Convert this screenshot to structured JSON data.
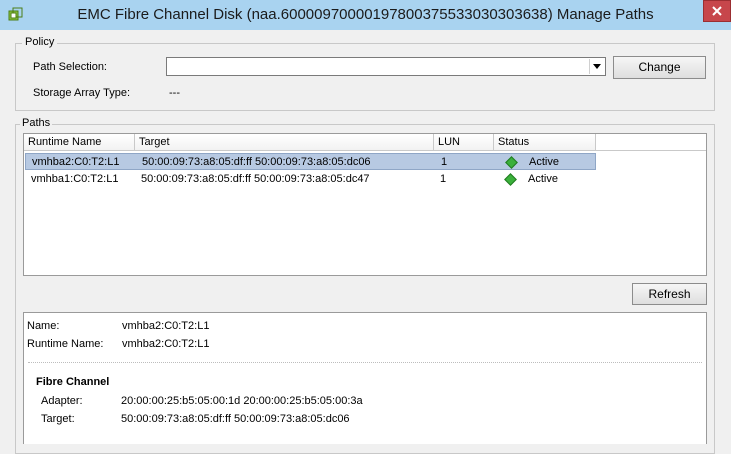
{
  "window": {
    "title": "EMC Fibre Channel Disk (naa.60000970000197800375533030303638) Manage Paths"
  },
  "policy": {
    "group_label": "Policy",
    "path_selection_label": "Path Selection:",
    "path_selection_value": "",
    "change_button": "Change",
    "storage_array_type_label": "Storage Array Type:",
    "storage_array_type_value": "---"
  },
  "paths": {
    "group_label": "Paths",
    "columns": [
      "Runtime Name",
      "Target",
      "LUN",
      "Status"
    ],
    "rows": [
      {
        "runtime_name": "vmhba2:C0:T2:L1",
        "target": "50:00:09:73:a8:05:df:ff 50:00:09:73:a8:05:dc06",
        "lun": "1",
        "status": "Active",
        "selected": true
      },
      {
        "runtime_name": "vmhba1:C0:T2:L1",
        "target": "50:00:09:73:a8:05:df:ff 50:00:09:73:a8:05:dc47",
        "lun": "1",
        "status": "Active",
        "selected": false
      }
    ],
    "refresh_button": "Refresh"
  },
  "details": {
    "name_label": "Name:",
    "name_value": "vmhba2:C0:T2:L1",
    "runtime_name_label": "Runtime Name:",
    "runtime_name_value": "vmhba2:C0:T2:L1",
    "section_title": "Fibre Channel",
    "adapter_label": "Adapter:",
    "adapter_value": "20:00:00:25:b5:05:00:1d 20:00:00:25:b5:05:00:3a",
    "target_label": "Target:",
    "target_value": "50:00:09:73:a8:05:df:ff 50:00:09:73:a8:05:dc06"
  },
  "colors": {
    "titlebar": "#a9d3f0",
    "selection": "#b7c9e2",
    "status_active": "#3bb03b"
  },
  "icons": [
    "vsphere-app-icon",
    "close-icon",
    "dropdown-arrow-icon",
    "active-status-icon"
  ]
}
